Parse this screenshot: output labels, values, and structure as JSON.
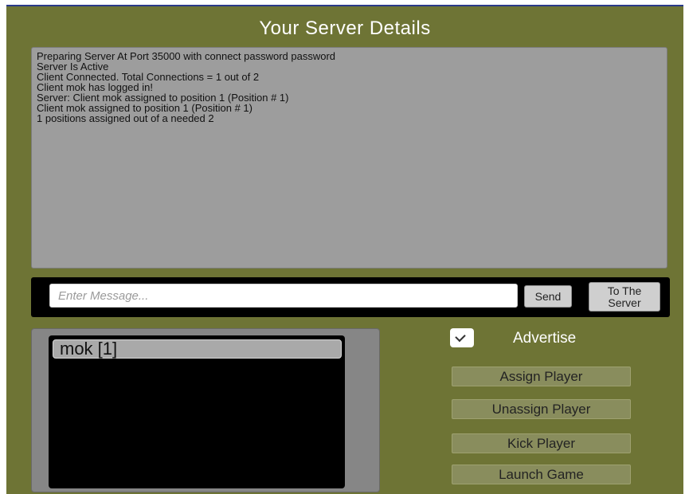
{
  "title": "Your Server Details",
  "log": {
    "lines": [
      "Preparing Server At Port 35000 with connect password password",
      "Server Is Active",
      "Client Connected. Total Connections = 1 out of 2",
      "Client mok has logged in!",
      "Server: Client mok assigned to position 1 (Position # 1)",
      "Client mok assigned to position 1 (Position # 1)",
      "1 positions assigned out of a needed 2"
    ]
  },
  "message": {
    "placeholder": "Enter Message...",
    "value": "",
    "send_label": "Send",
    "target_line1": "To The",
    "target_line2": "Server"
  },
  "players": {
    "items": [
      {
        "label": "mok [1]"
      }
    ]
  },
  "advertise": {
    "label": "Advertise",
    "checked": true
  },
  "actions": {
    "assign": "Assign Player",
    "unassign": "Unassign Player",
    "kick": "Kick Player",
    "launch": "Launch Game"
  },
  "colors": {
    "panel": "#6e7435",
    "log_bg": "#9d9d9d",
    "action_button": "#898d5d"
  }
}
